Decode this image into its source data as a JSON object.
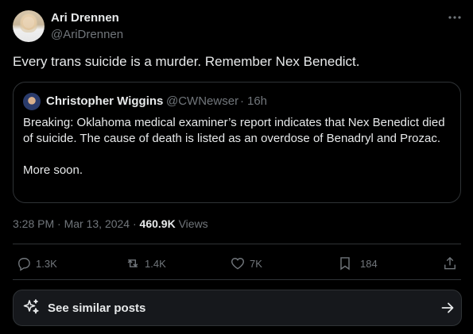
{
  "author": {
    "name": "Ari Drennen",
    "handle": "@AriDrennen"
  },
  "tweet": {
    "text": "Every trans suicide is a murder. Remember Nex Benedict."
  },
  "quoted": {
    "name": "Christopher Wiggins",
    "handle": "@CWNewser",
    "separator": "·",
    "time": "16h",
    "paragraphs": [
      "Breaking: Oklahoma medical examiner’s report indicates that Nex Benedict died of suicide. The cause of death is listed as an overdose of Benadryl and Prozac.",
      "More soon."
    ]
  },
  "meta": {
    "time": "3:28 PM",
    "date": "Mar 13, 2024",
    "separator": "·",
    "views_count": "460.9K",
    "views_label": "Views"
  },
  "actions": {
    "replies": "1.3K",
    "reposts": "1.4K",
    "likes": "7K",
    "bookmarks": "184"
  },
  "similar": {
    "label": "See similar posts"
  },
  "icons": {
    "more": "more-horizontal-icon",
    "reply": "reply-icon",
    "repost": "repost-icon",
    "like": "heart-icon",
    "bookmark": "bookmark-icon",
    "share": "share-icon",
    "sparkle": "sparkle-icon",
    "arrow": "arrow-right-icon"
  },
  "colors": {
    "background": "#000000",
    "text": "#e7e9ea",
    "secondary": "#71767b",
    "border": "#2f3336"
  }
}
